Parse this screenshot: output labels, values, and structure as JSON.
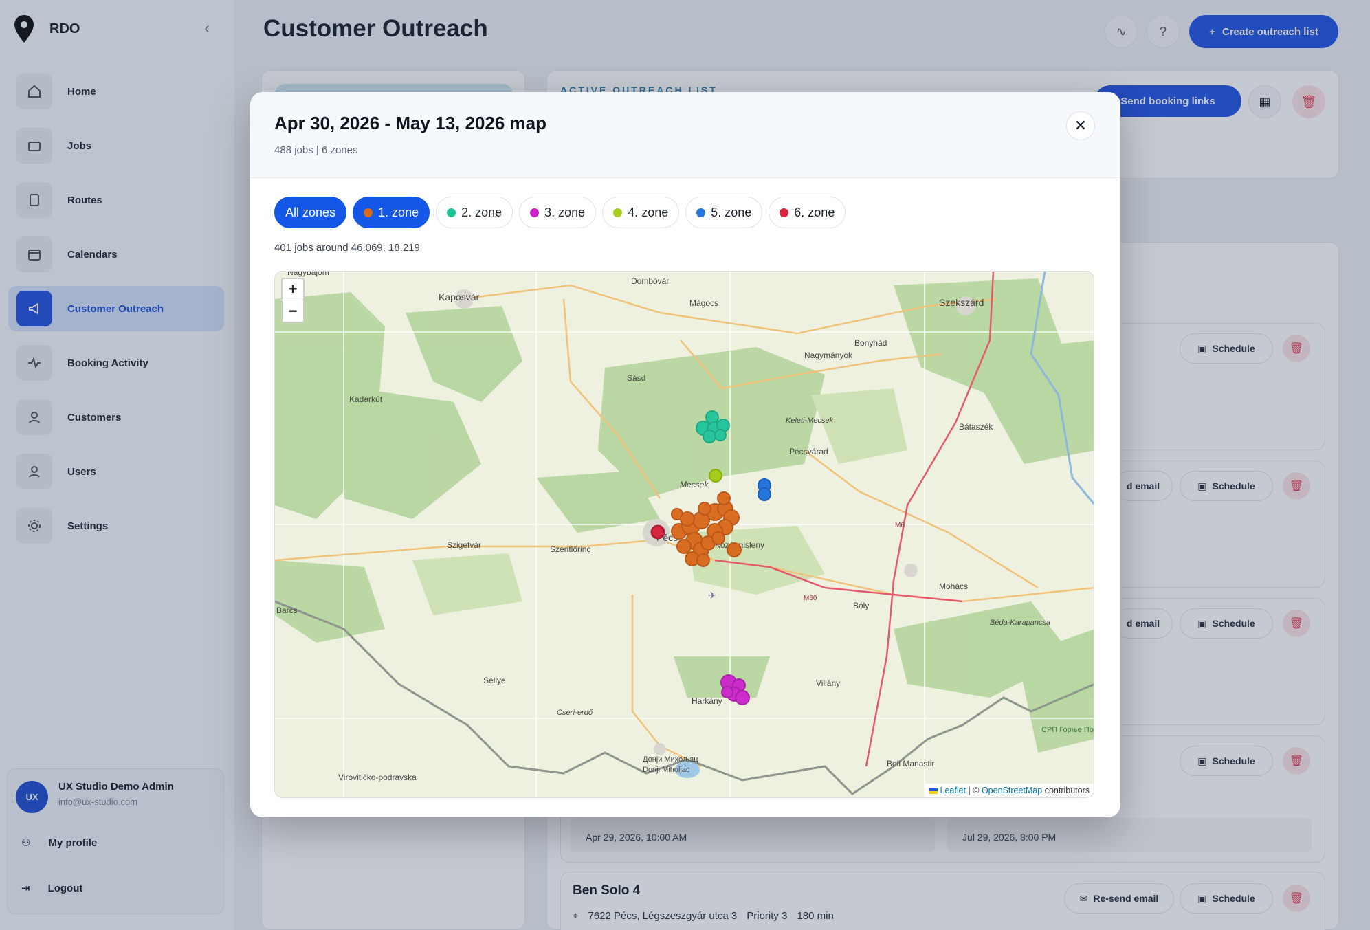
{
  "app": {
    "name": "RDO"
  },
  "sidebar": {
    "items": [
      {
        "label": "Home",
        "icon": "home-icon"
      },
      {
        "label": "Jobs",
        "icon": "briefcase-icon"
      },
      {
        "label": "Routes",
        "icon": "route-icon"
      },
      {
        "label": "Calendars",
        "icon": "calendar-icon"
      },
      {
        "label": "Customer Outreach",
        "icon": "megaphone-icon",
        "active": true
      },
      {
        "label": "Booking Activity",
        "icon": "activity-icon"
      },
      {
        "label": "Customers",
        "icon": "customers-icon"
      },
      {
        "label": "Users",
        "icon": "users-icon"
      },
      {
        "label": "Settings",
        "icon": "settings-icon"
      }
    ],
    "user": {
      "initials": "UX",
      "name": "UX Studio Demo Admin",
      "email": "info@ux-studio.com"
    },
    "menu": {
      "profile": "My profile",
      "logout": "Logout"
    }
  },
  "header": {
    "title": "Customer Outreach",
    "create_button": "Create outreach list"
  },
  "list": {
    "active_label": "ACTIVE OUTREACH LIST",
    "send_button": "Send booking links",
    "schedule": "Schedule",
    "resend": "Re-send email",
    "resend_short": "d email",
    "date_from": "Apr 29, 2026, 10:00 AM",
    "date_to": "Jul 29, 2026, 8:00 PM",
    "job": {
      "title": "Ben Solo 4",
      "address": "7622 Pécs, Légszeszgyár utca 3",
      "priority": "Priority 3",
      "duration": "180 min"
    }
  },
  "modal": {
    "title": "Apr 30, 2026 - May 13, 2026 map",
    "subtitle": "488 jobs | 6 zones",
    "jobs_info": "401 jobs around 46.069, 18.219",
    "chips": [
      {
        "label": "All zones",
        "selected": true
      },
      {
        "label": "1. zone",
        "color": "#d9691c",
        "selected": true
      },
      {
        "label": "2. zone",
        "color": "#1fc49b"
      },
      {
        "label": "3. zone",
        "color": "#cc22cc"
      },
      {
        "label": "4. zone",
        "color": "#a6cc1e"
      },
      {
        "label": "5. zone",
        "color": "#2575dc"
      },
      {
        "label": "6. zone",
        "color": "#d7263d"
      }
    ],
    "zoom_in": "+",
    "zoom_out": "−",
    "attribution": {
      "leaflet": "Leaflet",
      "sep": "| ©",
      "osm": "OpenStreetMap",
      "tail": "contributors"
    }
  },
  "map_labels": [
    "Nagybajom",
    "Kaposvár",
    "Dombóvár",
    "Mágocs",
    "Szekszárd",
    "Bonyhád",
    "Nagymányok",
    "Sásd",
    "Kadarkút",
    "Keleti-Mecsek",
    "Bátaszék",
    "Pécsvárad",
    "Mecsek",
    "Szigetvár",
    "Szentlőrinc",
    "Pécs",
    "Kozármisleny",
    "M6",
    "M60",
    "Bóly",
    "Mohács",
    "Béda-Karapancsa",
    "Barcs",
    "Sellye",
    "Villány",
    "Harkány",
    "Cserí-erdő",
    "Донји Михољац",
    "Donji Miholjac",
    "Virovitičko-podravska",
    "Beli Manastir",
    "СРП Горње Подунавље"
  ]
}
